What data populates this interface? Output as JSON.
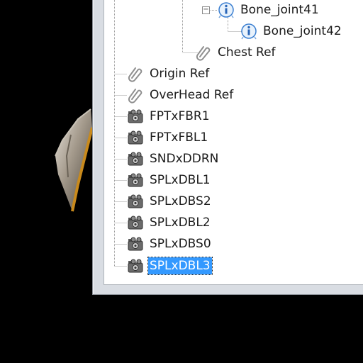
{
  "tree": {
    "nodes": [
      {
        "label": "Bone_joint41",
        "icon": "info-bone-icon",
        "expanded": true
      },
      {
        "label": "Bone_joint42",
        "icon": "info-bone-icon"
      },
      {
        "label": "Chest Ref",
        "icon": "paperclip-icon"
      },
      {
        "label": "Origin Ref",
        "icon": "paperclip-icon"
      },
      {
        "label": "OverHead Ref",
        "icon": "paperclip-icon"
      },
      {
        "label": "FPTxFBR1",
        "icon": "camera-icon"
      },
      {
        "label": "FPTxFBL1",
        "icon": "camera-icon"
      },
      {
        "label": "SNDxDDRN",
        "icon": "camera-icon"
      },
      {
        "label": "SPLxDBL1",
        "icon": "camera-icon"
      },
      {
        "label": "SPLxDBS2",
        "icon": "camera-icon"
      },
      {
        "label": "SPLxDBL2",
        "icon": "camera-icon"
      },
      {
        "label": "SPLxDBS0",
        "icon": "camera-icon"
      },
      {
        "label": "SPLxDBL3",
        "icon": "camera-icon",
        "selected": true
      }
    ]
  },
  "colors": {
    "selection": "#3399ff",
    "background": "#000000",
    "panel": "#ffffff",
    "frame": "#d9dde3"
  }
}
